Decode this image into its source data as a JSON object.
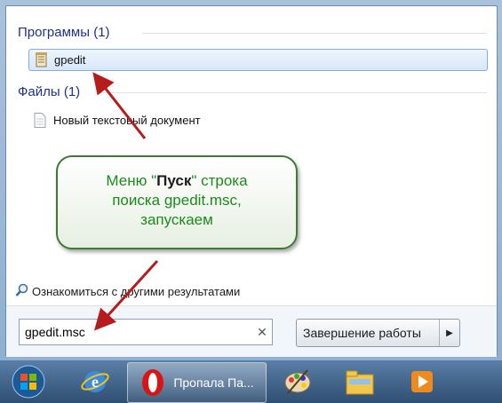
{
  "start_menu": {
    "programs_header": "Программы (1)",
    "program_item": "gpedit",
    "files_header": "Файлы (1)",
    "file_item": "Новый текстовый документ",
    "see_more": "Ознакомиться с другими результатами"
  },
  "search": {
    "value": "gpedit.msc",
    "clear_symbol": "✕"
  },
  "shutdown": {
    "label": "Завершение работы",
    "arrow": "▶"
  },
  "callout": {
    "line1_before": "Меню \"",
    "line1_bold": "Пуск",
    "line1_after": "\" строка",
    "line2": "поиска gpedit.msc,",
    "line3": "запускаем"
  },
  "taskbar": {
    "opera_label": "Пропала Па..."
  },
  "colors": {
    "header": "#1e3287",
    "callout_text": "#1d8a1d",
    "arrow": "#b71c1c"
  }
}
